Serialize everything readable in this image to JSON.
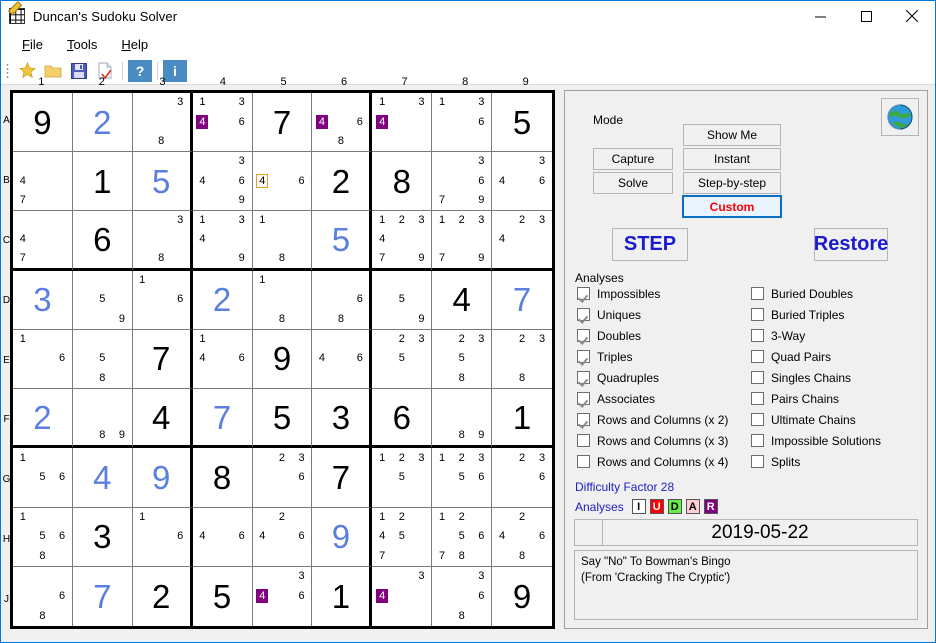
{
  "window": {
    "title": "Duncan's Sudoku Solver",
    "minimize_label": "minimize",
    "maximize_label": "maximize",
    "close_label": "close"
  },
  "menu": {
    "items": [
      "File",
      "Tools",
      "Help"
    ]
  },
  "toolbar": {
    "icons": [
      "star-icon",
      "folder-open-icon",
      "save-icon",
      "new-check-icon"
    ],
    "help_label": "?",
    "info_label": "i"
  },
  "grid": {
    "col_labels": [
      "1",
      "2",
      "3",
      "4",
      "5",
      "6",
      "7",
      "8",
      "9"
    ],
    "row_labels": [
      "A",
      "B",
      "C",
      "D",
      "E",
      "F",
      "G",
      "H",
      "J"
    ],
    "cells": [
      [
        {
          "v": "9",
          "s": "given"
        },
        {
          "v": "2",
          "s": "solved"
        },
        {
          "c": [
            3,
            8
          ]
        },
        {
          "c": [
            1,
            3,
            6
          ],
          "hl": [
            4
          ]
        },
        {
          "v": "7",
          "s": "given"
        },
        {
          "c": [
            6,
            8
          ],
          "hl": [
            4
          ]
        },
        {
          "c": [
            1,
            3
          ],
          "hl": [
            4
          ]
        },
        {
          "c": [
            1,
            3,
            6
          ]
        },
        {
          "v": "5",
          "s": "given"
        }
      ],
      [
        {
          "c": [
            4,
            7
          ]
        },
        {
          "v": "1",
          "s": "given"
        },
        {
          "v": "5",
          "s": "solved"
        },
        {
          "c": [
            3,
            4,
            6,
            9
          ]
        },
        {
          "c": [
            6
          ],
          "box": [
            4
          ]
        },
        {
          "v": "2",
          "s": "given"
        },
        {
          "v": "8",
          "s": "given"
        },
        {
          "c": [
            3,
            6,
            7,
            9
          ]
        },
        {
          "c": [
            3,
            4,
            6
          ]
        }
      ],
      [
        {
          "c": [
            4,
            7
          ]
        },
        {
          "v": "6",
          "s": "given"
        },
        {
          "c": [
            3,
            8
          ]
        },
        {
          "c": [
            1,
            3,
            4,
            9
          ]
        },
        {
          "c": [
            1,
            8
          ]
        },
        {
          "v": "5",
          "s": "solved"
        },
        {
          "c": [
            1,
            2,
            3,
            4,
            7,
            9
          ]
        },
        {
          "c": [
            1,
            2,
            3,
            7,
            9
          ]
        },
        {
          "c": [
            2,
            3,
            4
          ]
        }
      ],
      [
        {
          "v": "3",
          "s": "solved"
        },
        {
          "c": [
            5,
            9
          ]
        },
        {
          "c": [
            1,
            6
          ]
        },
        {
          "v": "2",
          "s": "solved"
        },
        {
          "c": [
            1,
            8
          ]
        },
        {
          "c": [
            6,
            8
          ]
        },
        {
          "c": [
            5,
            9
          ]
        },
        {
          "v": "4",
          "s": "given"
        },
        {
          "v": "7",
          "s": "solved"
        }
      ],
      [
        {
          "c": [
            1,
            6
          ]
        },
        {
          "c": [
            5,
            8
          ]
        },
        {
          "v": "7",
          "s": "given"
        },
        {
          "c": [
            1,
            4,
            6
          ]
        },
        {
          "v": "9",
          "s": "given"
        },
        {
          "c": [
            4,
            6
          ]
        },
        {
          "c": [
            2,
            3,
            5
          ]
        },
        {
          "c": [
            2,
            3,
            5,
            8
          ]
        },
        {
          "c": [
            2,
            3,
            8
          ]
        }
      ],
      [
        {
          "v": "2",
          "s": "solved"
        },
        {
          "c": [
            8,
            9
          ]
        },
        {
          "v": "4",
          "s": "given"
        },
        {
          "v": "7",
          "s": "solved"
        },
        {
          "v": "5",
          "s": "given"
        },
        {
          "v": "3",
          "s": "given"
        },
        {
          "v": "6",
          "s": "given"
        },
        {
          "c": [
            8,
            9
          ]
        },
        {
          "v": "1",
          "s": "given"
        }
      ],
      [
        {
          "c": [
            1,
            5,
            6
          ]
        },
        {
          "v": "4",
          "s": "solved"
        },
        {
          "v": "9",
          "s": "solved"
        },
        {
          "v": "8",
          "s": "given"
        },
        {
          "c": [
            2,
            3,
            6
          ]
        },
        {
          "v": "7",
          "s": "given"
        },
        {
          "c": [
            1,
            2,
            3,
            5
          ]
        },
        {
          "c": [
            1,
            2,
            3,
            5,
            6
          ]
        },
        {
          "c": [
            2,
            3,
            6
          ]
        }
      ],
      [
        {
          "c": [
            1,
            5,
            6,
            8
          ]
        },
        {
          "v": "3",
          "s": "given"
        },
        {
          "c": [
            1,
            6
          ]
        },
        {
          "c": [
            4,
            6
          ]
        },
        {
          "c": [
            2,
            4,
            6
          ]
        },
        {
          "v": "9",
          "s": "solved"
        },
        {
          "c": [
            1,
            2,
            4,
            5,
            7
          ]
        },
        {
          "c": [
            1,
            2,
            5,
            6,
            7,
            8
          ]
        },
        {
          "c": [
            2,
            4,
            6,
            8
          ]
        }
      ],
      [
        {
          "c": [
            6,
            8
          ]
        },
        {
          "v": "7",
          "s": "solved"
        },
        {
          "v": "2",
          "s": "given"
        },
        {
          "v": "5",
          "s": "given"
        },
        {
          "c": [
            3,
            6
          ],
          "hl": [
            4
          ]
        },
        {
          "v": "1",
          "s": "given"
        },
        {
          "c": [
            3
          ],
          "hl": [
            4
          ]
        },
        {
          "c": [
            3,
            6,
            8
          ]
        },
        {
          "v": "9",
          "s": "given"
        }
      ]
    ]
  },
  "panel": {
    "mode_label": "Mode",
    "globe_icon": "globe-icon",
    "mode_buttons_left": [
      "Capture",
      "Solve"
    ],
    "mode_buttons_right": [
      "Show Me",
      "Instant",
      "Step-by-step",
      "Custom"
    ],
    "selected_mode": "Custom",
    "step_label": "STEP",
    "restore_label": "Restore",
    "analyses_label": "Analyses",
    "analyses_left": [
      {
        "label": "Impossibles",
        "checked": true
      },
      {
        "label": "Uniques",
        "checked": true
      },
      {
        "label": "Doubles",
        "checked": true
      },
      {
        "label": "Triples",
        "checked": true
      },
      {
        "label": "Quadruples",
        "checked": true
      },
      {
        "label": "Associates",
        "checked": true
      },
      {
        "label": "Rows and Columns (x 2)",
        "checked": true
      },
      {
        "label": "Rows and Columns (x 3)",
        "checked": false
      },
      {
        "label": "Rows and Columns (x 4)",
        "checked": false
      }
    ],
    "analyses_right": [
      {
        "label": "Buried Doubles",
        "checked": false
      },
      {
        "label": "Buried Triples",
        "checked": false
      },
      {
        "label": "3-Way",
        "checked": false
      },
      {
        "label": "Quad Pairs",
        "checked": false
      },
      {
        "label": "Singles Chains",
        "checked": false
      },
      {
        "label": "Pairs Chains",
        "checked": false
      },
      {
        "label": "Ultimate Chains",
        "checked": false
      },
      {
        "label": "Impossible Solutions",
        "checked": false
      },
      {
        "label": "Splits",
        "checked": false
      }
    ],
    "difficulty_text": "Difficulty Factor 28",
    "analyses_tags_label": "Analyses",
    "analyses_tags": [
      {
        "letter": "I",
        "bg": "#ffffff",
        "fg": "#000000"
      },
      {
        "letter": "U",
        "bg": "#ff0000",
        "fg": "#ffffff"
      },
      {
        "letter": "D",
        "bg": "#66ee44",
        "fg": "#000000"
      },
      {
        "letter": "A",
        "bg": "#ffd0d0",
        "fg": "#000000"
      },
      {
        "letter": "R",
        "bg": "#800080",
        "fg": "#ffffff"
      }
    ],
    "date": "2019-05-22",
    "notes_line1": "Say \"No\" To Bowman's Bingo",
    "notes_line2": "(From 'Cracking The Cryptic')"
  },
  "colors": {
    "accent": "#0078d7",
    "solved_digit": "#5b7fe0",
    "highlight_candidate": "#800080",
    "boxed_candidate": "#e8a020",
    "info_text": "#2020c0"
  }
}
